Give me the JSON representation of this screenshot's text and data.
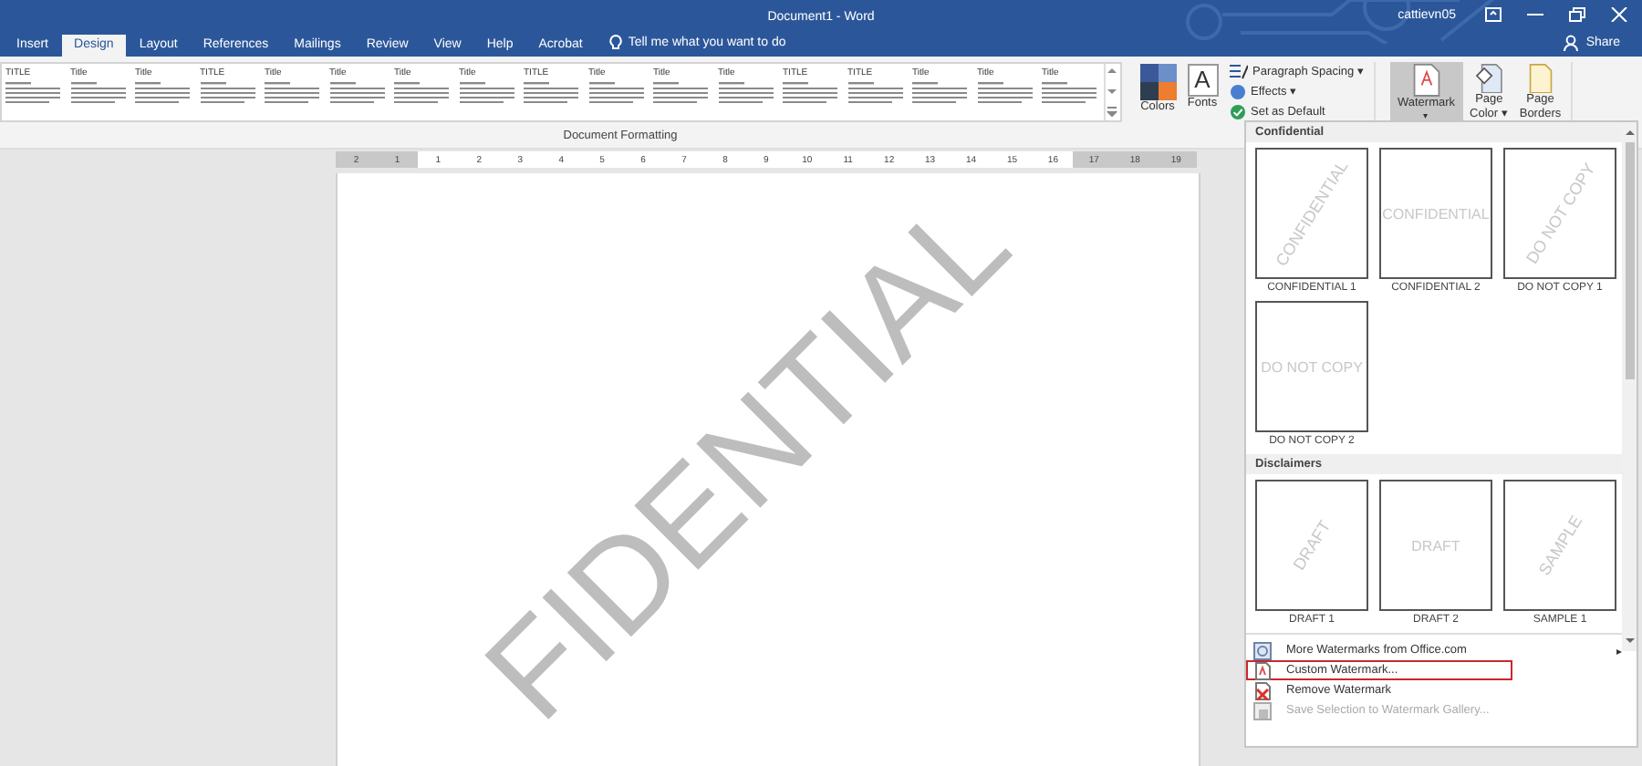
{
  "window": {
    "title": "Document1  -  Word",
    "user": "cattievn05",
    "share": "Share"
  },
  "tabs": [
    {
      "label": "Insert",
      "selected": false
    },
    {
      "label": "Design",
      "selected": true
    },
    {
      "label": "Layout",
      "selected": false
    },
    {
      "label": "References",
      "selected": false
    },
    {
      "label": "Mailings",
      "selected": false
    },
    {
      "label": "Review",
      "selected": false
    },
    {
      "label": "View",
      "selected": false
    },
    {
      "label": "Help",
      "selected": false
    },
    {
      "label": "Acrobat",
      "selected": false
    }
  ],
  "tell_me": "Tell me what you want to do",
  "style_sets": [
    {
      "title": "TITLE"
    },
    {
      "title": "Title"
    },
    {
      "title": "Title"
    },
    {
      "title": "TITLE"
    },
    {
      "title": "Title"
    },
    {
      "title": "Title"
    },
    {
      "title": "Title"
    },
    {
      "title": "Title"
    },
    {
      "title": "TITLE"
    },
    {
      "title": "Title"
    },
    {
      "title": "Title"
    },
    {
      "title": "Title"
    },
    {
      "title": "TITLE"
    },
    {
      "title": "TITLE"
    },
    {
      "title": "Title"
    },
    {
      "title": "Title"
    },
    {
      "title": "Title"
    }
  ],
  "ribbon": {
    "colors": "Colors",
    "fonts_glyph": "A",
    "fonts": "Fonts",
    "paragraph_spacing": "Paragraph Spacing",
    "paragraph_spacing_caret": "▾",
    "effects": "Effects",
    "effects_caret": "▾",
    "watermark_caret": "▾",
    "page_color_caret": "▾",
    "set_default": "Set as Default",
    "watermark": "Watermark",
    "page_color": [
      "Page",
      "Color"
    ],
    "page_borders": [
      "Page",
      "Borders"
    ],
    "group": "Document Formatting"
  },
  "ruler": [
    {
      "label": "2",
      "margin": true
    },
    {
      "label": "1",
      "margin": true
    },
    {
      "label": "1",
      "margin": false
    },
    {
      "label": "2",
      "margin": false
    },
    {
      "label": "3",
      "margin": false
    },
    {
      "label": "4",
      "margin": false
    },
    {
      "label": "5",
      "margin": false
    },
    {
      "label": "6",
      "margin": false
    },
    {
      "label": "7",
      "margin": false
    },
    {
      "label": "8",
      "margin": false
    },
    {
      "label": "9",
      "margin": false
    },
    {
      "label": "10",
      "margin": false
    },
    {
      "label": "11",
      "margin": false
    },
    {
      "label": "12",
      "margin": false
    },
    {
      "label": "13",
      "margin": false
    },
    {
      "label": "14",
      "margin": false
    },
    {
      "label": "15",
      "margin": false
    },
    {
      "label": "16",
      "margin": false
    },
    {
      "label": "17",
      "margin": true
    },
    {
      "label": "18",
      "margin": true
    },
    {
      "label": "19",
      "margin": true
    }
  ],
  "document": {
    "watermark_text": "FIDENTIAL"
  },
  "watermark_menu": {
    "sections": [
      {
        "heading": "Confidential",
        "items": [
          {
            "label": "CONFIDENTIAL 1",
            "text": "CONFIDENTIAL",
            "kind": "diagonal"
          },
          {
            "label": "CONFIDENTIAL 2",
            "text": "CONFIDENTIAL",
            "kind": "horizontal"
          },
          {
            "label": "DO NOT COPY 1",
            "text": "DO NOT COPY",
            "kind": "diagonal"
          },
          {
            "label": "DO NOT COPY 2",
            "text": "DO NOT COPY",
            "kind": "horizontal"
          }
        ]
      },
      {
        "heading": "Disclaimers",
        "items": [
          {
            "label": "DRAFT 1",
            "text": "DRAFT",
            "kind": "diagonal"
          },
          {
            "label": "DRAFT 2",
            "text": "DRAFT",
            "kind": "horizontal"
          },
          {
            "label": "SAMPLE 1",
            "text": "SAMPLE",
            "kind": "diagonal"
          }
        ]
      }
    ],
    "commands": [
      {
        "label": "More Watermarks from Office.com",
        "submenu_glyph": "▸",
        "highlighted": false,
        "disabled": false,
        "kind": "more"
      },
      {
        "label": "Custom Watermark...",
        "highlighted": true,
        "disabled": false,
        "kind": "custom"
      },
      {
        "label": "Remove Watermark",
        "highlighted": false,
        "disabled": false,
        "kind": "remove"
      },
      {
        "label": "Save Selection to Watermark Gallery...",
        "highlighted": false,
        "disabled": true,
        "kind": "save"
      }
    ]
  }
}
